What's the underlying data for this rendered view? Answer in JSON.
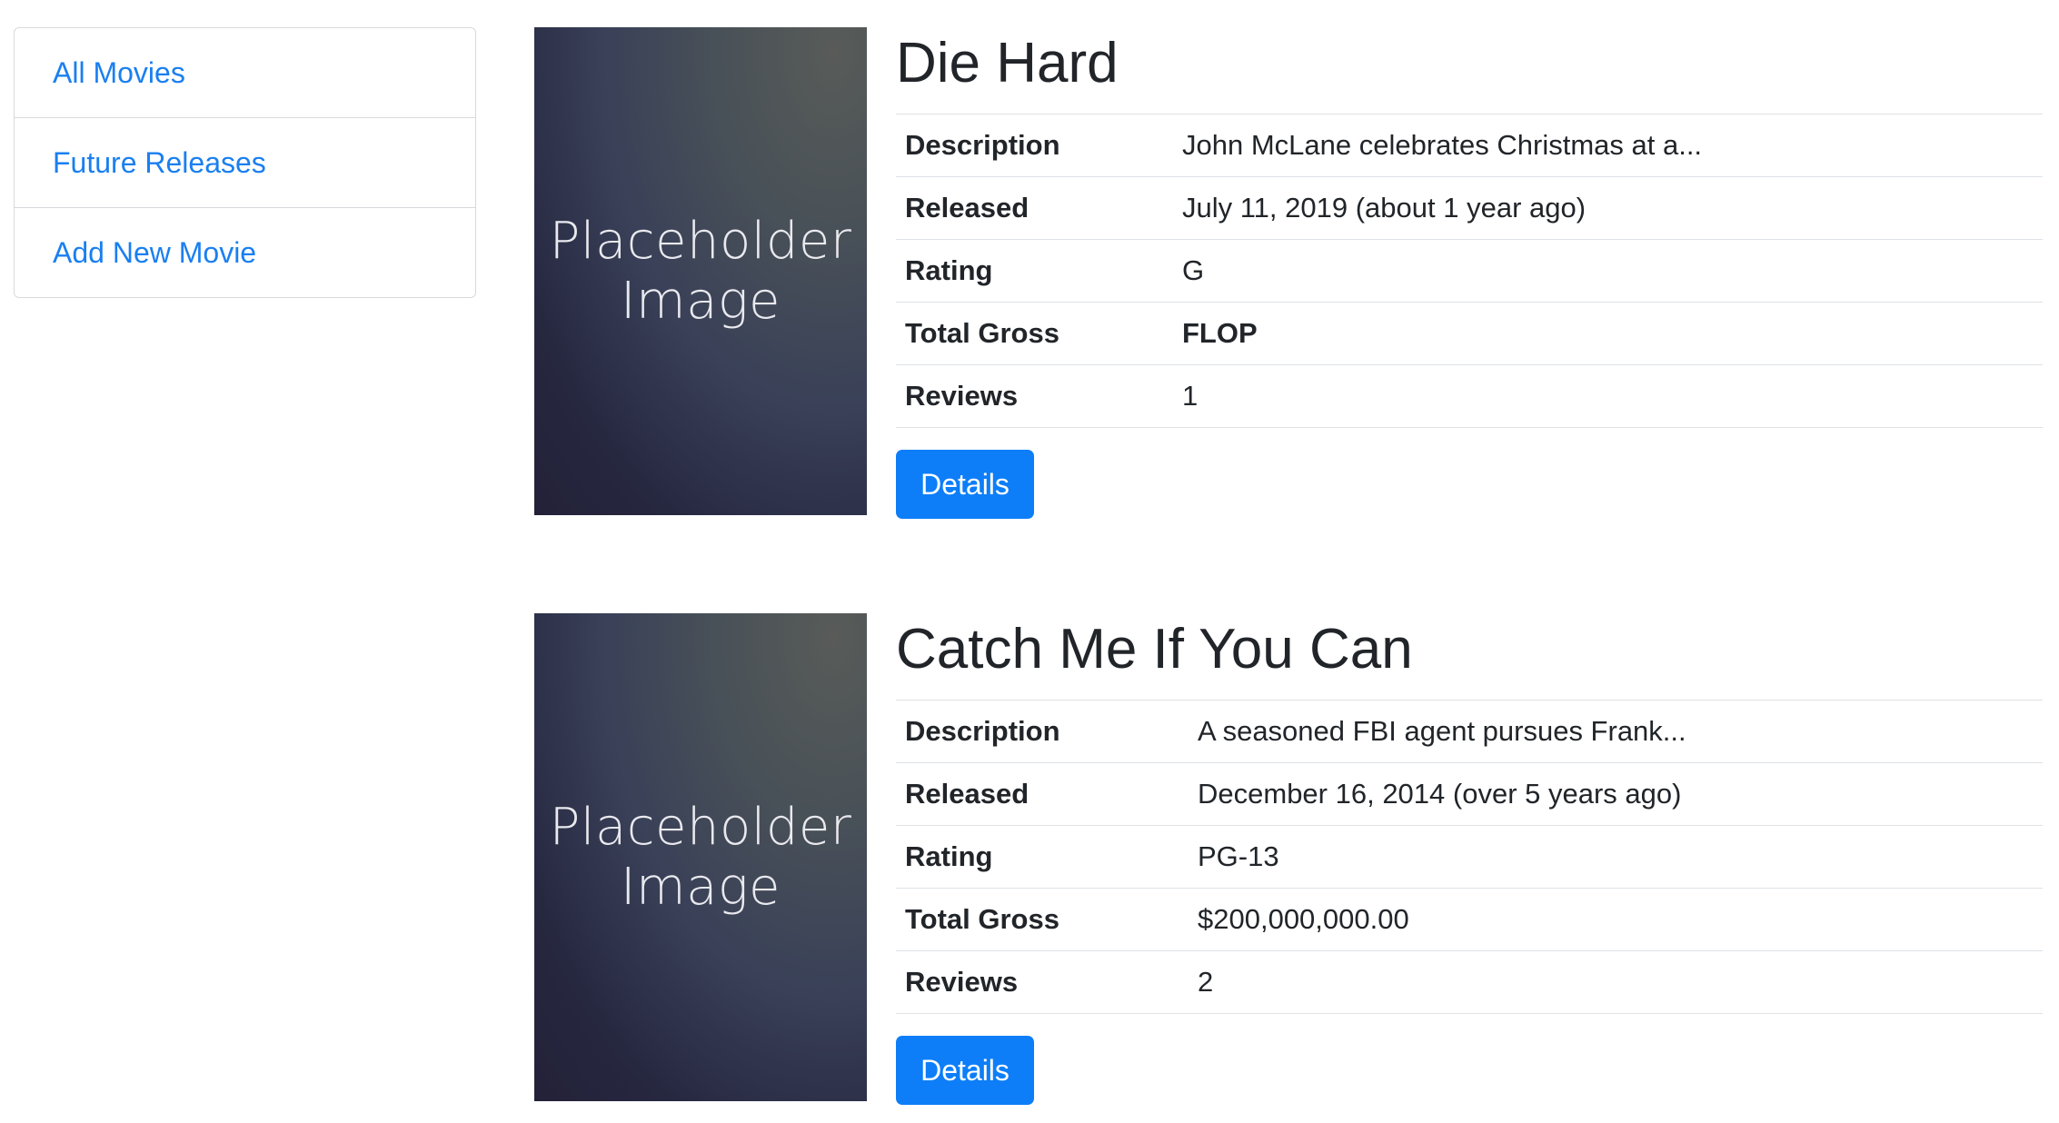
{
  "sidebar": {
    "items": [
      {
        "label": "All Movies"
      },
      {
        "label": "Future Releases"
      },
      {
        "label": "Add New Movie"
      }
    ]
  },
  "movies": [
    {
      "title": "Die Hard",
      "poster_text_1": "Placeholder",
      "poster_text_2": "Image",
      "rows": [
        {
          "key": "Description",
          "value": "John McLane celebrates Christmas at a..."
        },
        {
          "key": "Released",
          "value": "July 11, 2019 (about 1 year ago)"
        },
        {
          "key": "Rating",
          "value": "G"
        },
        {
          "key": "Total Gross",
          "value": "FLOP"
        },
        {
          "key": "Reviews",
          "value": "1"
        }
      ],
      "details_label": "Details"
    },
    {
      "title": "Catch Me If You Can",
      "poster_text_1": "Placeholder",
      "poster_text_2": "Image",
      "rows": [
        {
          "key": "Description",
          "value": "A seasoned FBI agent pursues Frank..."
        },
        {
          "key": "Released",
          "value": "December 16, 2014 (over 5 years ago)"
        },
        {
          "key": "Rating",
          "value": "PG-13"
        },
        {
          "key": "Total Gross",
          "value": "$200,000,000.00"
        },
        {
          "key": "Reviews",
          "value": "2"
        }
      ],
      "details_label": "Details"
    }
  ],
  "colors": {
    "link": "#1a7ff0",
    "button": "#0d7ef8",
    "text": "#212529",
    "border": "#dee2e6"
  }
}
